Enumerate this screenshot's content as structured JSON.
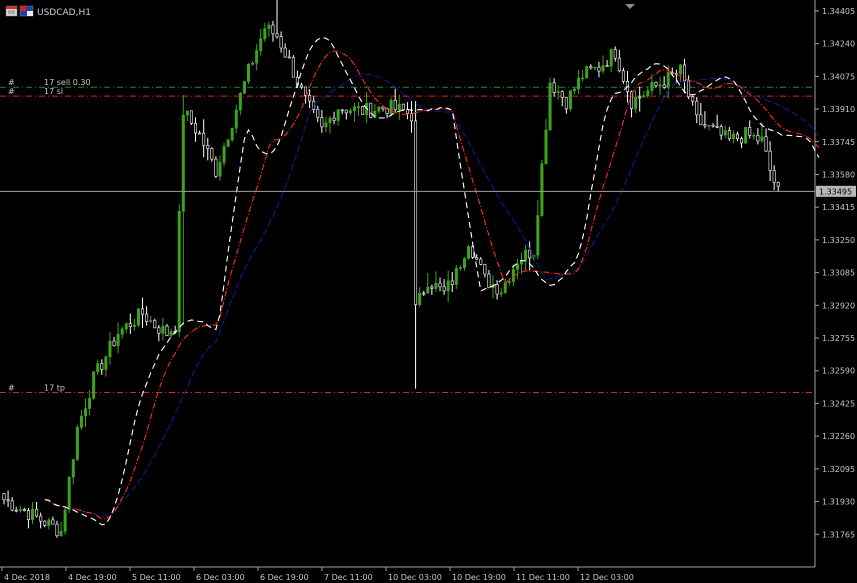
{
  "window": {
    "title": "USDCAD,H1",
    "icons": [
      "chart-window-icon",
      "symbol-flag-icon"
    ]
  },
  "colors": {
    "background": "#000000",
    "grid_axis": "#a0a0a0",
    "bull_candle": "#3ea31f",
    "bear_candle": "#ffffff",
    "ma_fast": "#ffffff",
    "ma_mid": "#ff2a1a",
    "ma_slow": "#0d1d8c",
    "order_sell": "#1f8a2a",
    "order_sl": "#d9271b",
    "order_tp": "#d9271b",
    "price_line": "#a0a0a0"
  },
  "orders": [
    {
      "marker": "#",
      "label": "17 sell 0.30",
      "price": 1.3402,
      "kind": "sell"
    },
    {
      "marker": "#",
      "label": "17 sl",
      "price": 1.33975,
      "kind": "sl"
    },
    {
      "marker": "#",
      "label": "17 tp",
      "price": 1.3248,
      "kind": "tp"
    }
  ],
  "current_price": "1.33495",
  "chart_data": {
    "type": "candlestick",
    "symbol": "USDCAD",
    "timeframe": "H1",
    "ylim": [
      1.316,
      1.3446
    ],
    "y_ticks": [
      "1.34405",
      "1.34240",
      "1.34075",
      "1.33910",
      "1.33745",
      "1.33580",
      "1.33415",
      "1.33250",
      "1.33085",
      "1.32920",
      "1.32755",
      "1.32590",
      "1.32425",
      "1.32260",
      "1.32095",
      "1.31930",
      "1.31765"
    ],
    "x_ticks": [
      "4 Dec 2018",
      "4 Dec 19:00",
      "5 Dec 11:00",
      "6 Dec 03:00",
      "6 Dec 19:00",
      "7 Dec 11:00",
      "10 Dec 03:00",
      "10 Dec 19:00",
      "11 Dec 11:00",
      "12 Dec 03:00"
    ],
    "close_waypoints": [
      [
        0,
        1.3194
      ],
      [
        8,
        1.3185
      ],
      [
        14,
        1.3178
      ],
      [
        18,
        1.323
      ],
      [
        22,
        1.3255
      ],
      [
        28,
        1.3278
      ],
      [
        34,
        1.3288
      ],
      [
        37,
        1.3282
      ],
      [
        40,
        1.3278
      ],
      [
        42,
        1.3282
      ],
      [
        44,
        1.339
      ],
      [
        48,
        1.3378
      ],
      [
        52,
        1.336
      ],
      [
        56,
        1.3385
      ],
      [
        60,
        1.341
      ],
      [
        64,
        1.3432
      ],
      [
        67,
        1.3428
      ],
      [
        70,
        1.3415
      ],
      [
        74,
        1.3395
      ],
      [
        78,
        1.338
      ],
      [
        82,
        1.3392
      ],
      [
        88,
        1.339
      ],
      [
        94,
        1.3392
      ],
      [
        98,
        1.339
      ],
      [
        100,
        1.3388
      ],
      [
        101,
        1.329
      ],
      [
        104,
        1.3305
      ],
      [
        108,
        1.3298
      ],
      [
        111,
        1.3308
      ],
      [
        114,
        1.3325
      ],
      [
        118,
        1.3305
      ],
      [
        122,
        1.33
      ],
      [
        126,
        1.3315
      ],
      [
        130,
        1.332
      ],
      [
        134,
        1.3405
      ],
      [
        138,
        1.3395
      ],
      [
        142,
        1.3408
      ],
      [
        146,
        1.3412
      ],
      [
        150,
        1.342
      ],
      [
        154,
        1.3395
      ],
      [
        158,
        1.34
      ],
      [
        162,
        1.3405
      ],
      [
        166,
        1.341
      ],
      [
        170,
        1.3385
      ],
      [
        174,
        1.338
      ],
      [
        178,
        1.3375
      ],
      [
        182,
        1.3378
      ],
      [
        186,
        1.3375
      ],
      [
        188,
        1.336
      ],
      [
        190,
        1.3349
      ]
    ],
    "ma_fast": {
      "name": "",
      "lag": 6,
      "style": "dashed-white"
    },
    "ma_mid": {
      "name": "",
      "lag": 12,
      "style": "dashdot-red"
    },
    "ma_slow": {
      "name": "",
      "lag": 22,
      "style": "dashed-navy"
    }
  }
}
